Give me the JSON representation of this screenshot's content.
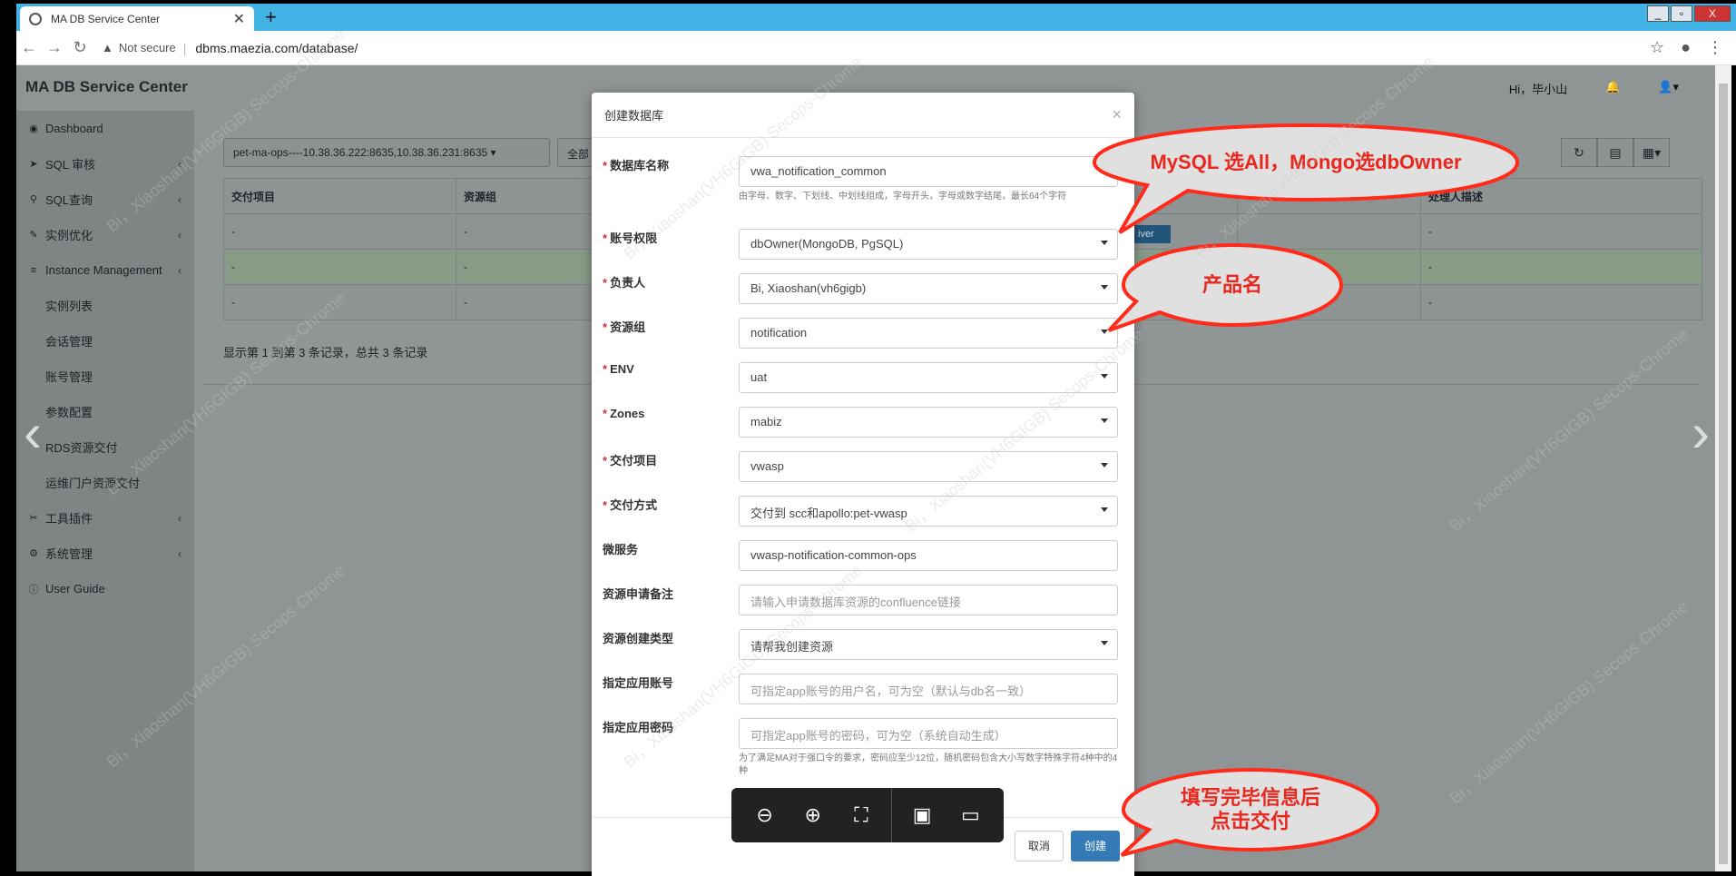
{
  "browser": {
    "tab_title": "MA DB Service Center",
    "new_tab": "+",
    "secure_label": "Not secure",
    "url": "dbms.maezia.com/database/",
    "win_controls": [
      "_",
      "▫",
      "X"
    ]
  },
  "app": {
    "title": "MA DB Service Center",
    "greeting": "Hi，毕小山",
    "bell_icon": "bell-icon",
    "user_icon": "user-icon"
  },
  "sidebar": {
    "items": [
      {
        "label": "Dashboard",
        "icon": "dashboard-icon"
      },
      {
        "label": "SQL 审核",
        "icon": "rocket-icon",
        "chevron": "‹"
      },
      {
        "label": "SQL查询",
        "icon": "search-icon",
        "chevron": "‹"
      },
      {
        "label": "实例优化",
        "icon": "wrench-icon",
        "chevron": "‹"
      },
      {
        "label": "Instance Management",
        "icon": "database-icon",
        "chevron": "‹"
      }
    ],
    "sub_items": [
      "实例列表",
      "会话管理",
      "账号管理",
      "参数配置",
      "RDS资源交付",
      "运维门户资源交付"
    ],
    "items2": [
      {
        "label": "工具插件",
        "icon": "tools-icon",
        "chevron": "‹"
      },
      {
        "label": "系统管理",
        "icon": "cogs-icon",
        "chevron": "‹"
      },
      {
        "label": "User Guide",
        "icon": "info-icon"
      }
    ]
  },
  "main": {
    "instance_select": "pet-ma-ops----10.38.36.222:8635,10.38.36.231:8635",
    "filter_select": "全部",
    "table_headers": [
      "交付项目",
      "资源组",
      "",
      "",
      "",
      "",
      "处理人描述"
    ],
    "rows": [
      [
        "-",
        "-",
        "",
        "",
        "",
        "",
        "-"
      ],
      [
        "-",
        "-",
        "",
        "",
        "",
        "",
        "-"
      ],
      [
        "-",
        "-",
        "",
        "",
        "",
        "",
        "-"
      ]
    ],
    "chip_text": "iver",
    "records_text": "显示第 1 到第 3 条记录，总共 3 条记录"
  },
  "modal": {
    "title": "创建数据库",
    "close": "×",
    "fields": {
      "db_name": {
        "label": "数据库名称",
        "value": "vwa_notification_common",
        "help": "由字母、数字、下划线、中划线组成，字母开头，字母或数字结尾，最长64个字符"
      },
      "account_perm": {
        "label": "账号权限",
        "value": "dbOwner(MongoDB, PgSQL)"
      },
      "owner": {
        "label": "负责人",
        "value": "Bi, Xiaoshan(vh6gigb)"
      },
      "resource_group": {
        "label": "资源组",
        "value": "notification"
      },
      "env": {
        "label": "ENV",
        "value": "uat"
      },
      "zones": {
        "label": "Zones",
        "value": "mabiz"
      },
      "delivery_project": {
        "label": "交付项目",
        "value": "vwasp"
      },
      "delivery_method": {
        "label": "交付方式",
        "value": "交付到 scc和apollo:pet-vwasp"
      },
      "microservice": {
        "label": "微服务",
        "value": "vwasp-notification-common-ops"
      },
      "remark": {
        "label": "资源申请备注",
        "placeholder": "请输入申请数据库资源的confluence链接"
      },
      "create_type": {
        "label": "资源创建类型",
        "value": "请帮我创建资源"
      },
      "app_account": {
        "label": "指定应用账号",
        "placeholder": "可指定app账号的用户名，可为空（默认与db名一致）"
      },
      "app_password": {
        "label": "指定应用密码",
        "placeholder": "可指定app账号的密码，可为空（系统自动生成）",
        "help": "为了满足MA对于强口令的要求，密码应至少12位，随机密码包含大小写数字特殊字符4种中的4种"
      }
    },
    "cancel": "取消",
    "create": "创建"
  },
  "callouts": {
    "c1": "MySQL 选All，Mongo选dbOwner",
    "c2": "产品名",
    "c3_line1": "填写完毕信息后",
    "c3_line2": "点击交付"
  },
  "viewer": {
    "icons": [
      "zoom-out-icon",
      "zoom-in-icon",
      "fullscreen-icon",
      "present-icon",
      "comment-icon"
    ]
  },
  "watermark": "Bi，Xiaoshan(VH6GIGB) Secops-Chrome",
  "colors": {
    "callout_fill": "#e0e0e0",
    "callout_stroke": "#ff2a1a",
    "callout_text": "#e8281e",
    "primary": "#337ab7",
    "tabstrip": "#41b3e4"
  }
}
